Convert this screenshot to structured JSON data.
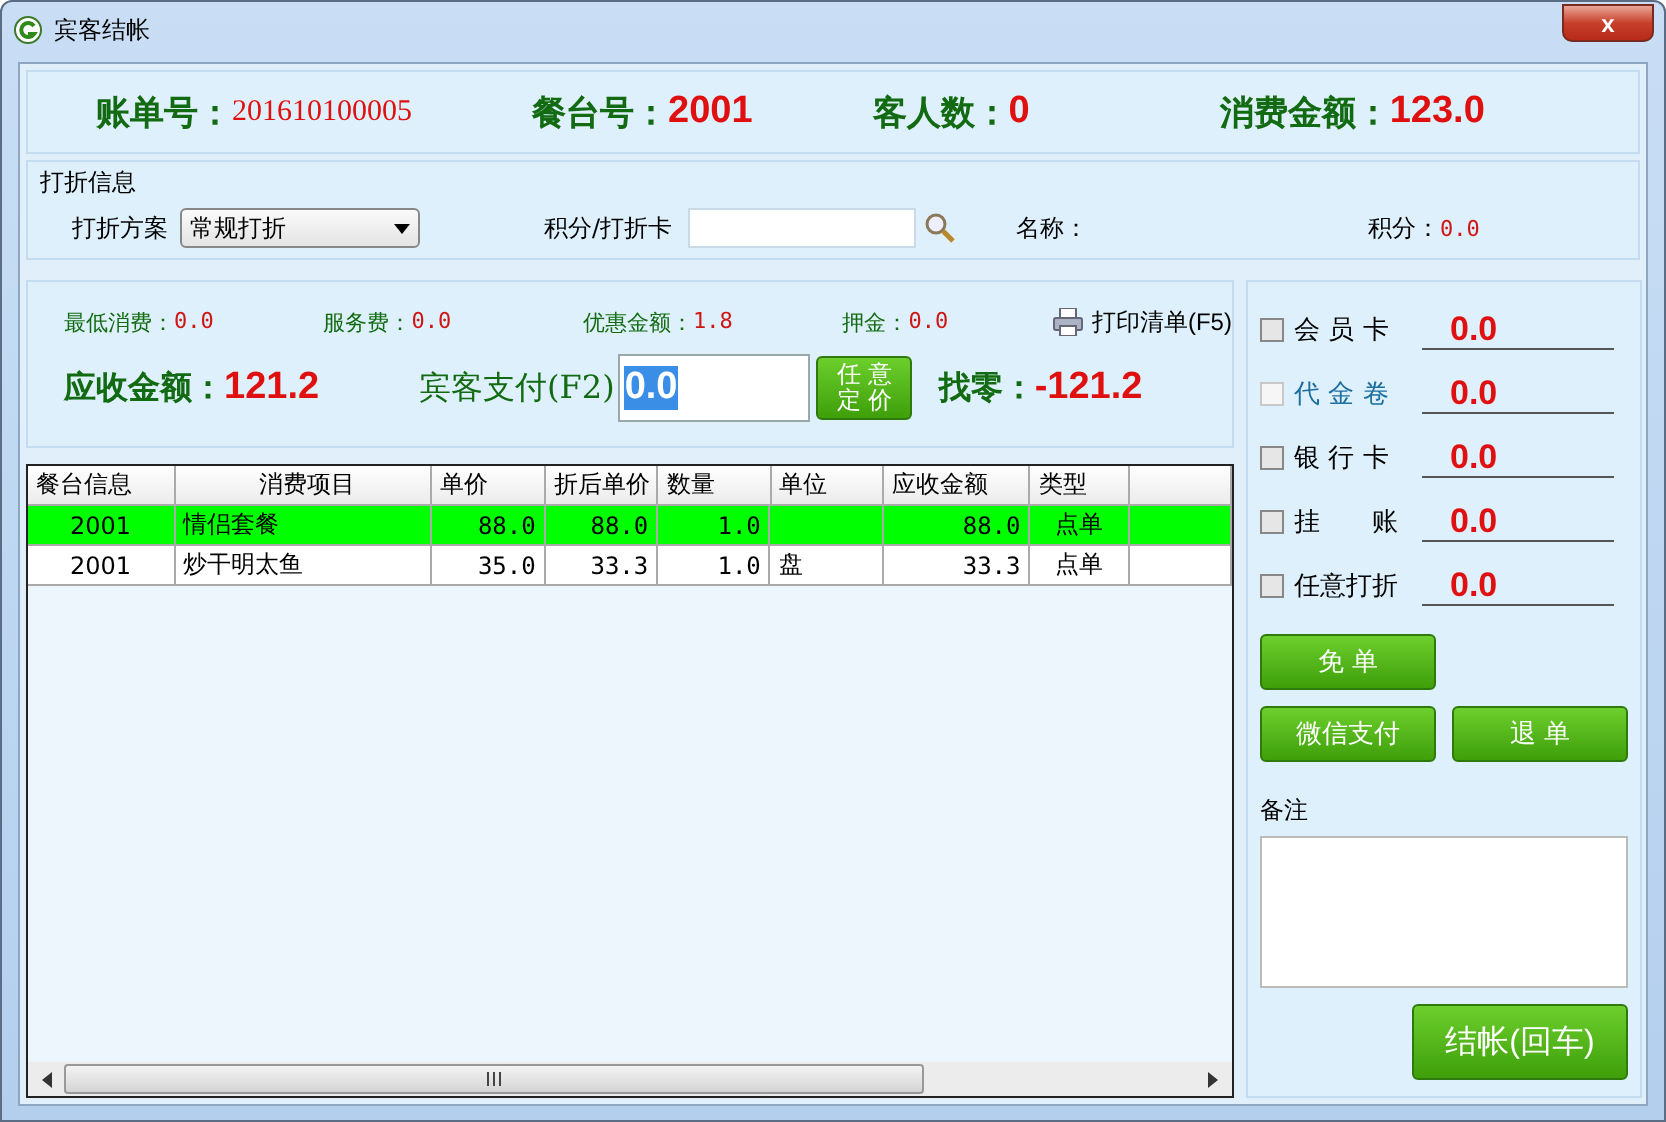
{
  "window": {
    "title": "宾客结帐",
    "close": "x"
  },
  "header": [
    {
      "label": "账单号：",
      "value": "201610100005",
      "kind": "serif"
    },
    {
      "label": "餐台号：",
      "value": "2001",
      "kind": "big"
    },
    {
      "label": "客人数：",
      "value": "0",
      "kind": "big"
    },
    {
      "label": "消费金额：",
      "value": "123.0",
      "kind": "big"
    }
  ],
  "discount": {
    "title": "打折信息",
    "scheme_label": "打折方案",
    "scheme": "常规打折",
    "card_label": "积分/打折卡",
    "name_label": "名称：",
    "points_label": "积分：",
    "points": "0.0"
  },
  "summary": [
    {
      "label": "最低消费：",
      "value": "0.0"
    },
    {
      "label": "服务费：",
      "value": "0.0"
    },
    {
      "label": "优惠金额：",
      "value": "1.8"
    },
    {
      "label": "押金：",
      "value": "0.0"
    }
  ],
  "print_button": "打印清单(F5)",
  "receivable": {
    "label": "应收金额：",
    "value": "121.2"
  },
  "pay": {
    "label": "宾客支付(F2)",
    "value": "0.0",
    "button": "任 意定 价"
  },
  "change": {
    "label": "找零：",
    "value": "-121.2"
  },
  "table": {
    "columns": [
      "餐台信息",
      "消费项目",
      "单价",
      "折后单价",
      "数量",
      "单位",
      "应收金额",
      "类型"
    ],
    "rows": [
      {
        "selected": true,
        "cells": [
          "2001",
          "情侣套餐",
          "88.0",
          "88.0",
          "1.0",
          "",
          "88.0",
          "点单"
        ]
      },
      {
        "selected": false,
        "cells": [
          "2001",
          "炒干明太鱼",
          "35.0",
          "33.3",
          "1.0",
          "盘",
          "33.3",
          "点单"
        ]
      }
    ]
  },
  "payments": [
    {
      "label": "会 员 卡",
      "value": "0.0",
      "checked": false,
      "disabled": false
    },
    {
      "label": "代 金 卷",
      "value": "0.0",
      "checked": false,
      "disabled": true
    },
    {
      "label": "银 行 卡",
      "value": "0.0",
      "checked": false,
      "disabled": false
    },
    {
      "label": "挂　　账",
      "value": "0.0",
      "checked": false,
      "disabled": false
    },
    {
      "label": "任意打折",
      "value": "0.0",
      "checked": false,
      "disabled": false
    }
  ],
  "actions": [
    "免 单",
    "微信支付",
    "退 单"
  ],
  "note": {
    "label": "备注"
  },
  "checkout": "结帐(回车)"
}
